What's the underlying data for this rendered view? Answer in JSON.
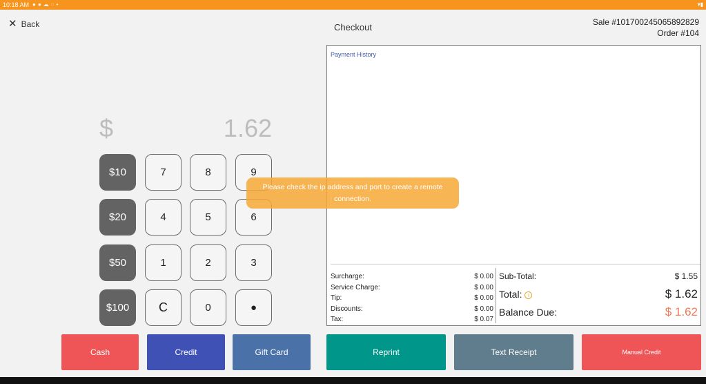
{
  "status_bar": {
    "time": "10:18 AM",
    "icons": [
      "sync-icon",
      "check-icon",
      "cloud-icon",
      "alert-icon",
      "dot-icon"
    ]
  },
  "header": {
    "back_label": "Back",
    "title": "Checkout",
    "sale_number": "Sale #1017002450658​92829",
    "order_number": "Order #104"
  },
  "amount": {
    "currency": "$",
    "value": "1.62"
  },
  "keypad": {
    "presets": [
      "$10",
      "$20",
      "$50",
      "$100"
    ],
    "digits": [
      "7",
      "8",
      "9",
      "4",
      "5",
      "6",
      "1",
      "2",
      "3",
      "C",
      "0",
      "●"
    ]
  },
  "payment_history": {
    "label": "Payment History"
  },
  "fees": [
    {
      "label": "Surcharge:",
      "value": "$ 0.00"
    },
    {
      "label": "Service Charge:",
      "value": "$ 0.00"
    },
    {
      "label": "Tip:",
      "value": "$ 0.00"
    },
    {
      "label": "Discounts:",
      "value": "$ 0.00"
    },
    {
      "label": "Tax:",
      "value": "$ 0.07"
    }
  ],
  "totals": {
    "subtotal_label": "Sub-Total:",
    "subtotal_value": "$ 1.55",
    "total_label": "Total:",
    "total_value": "$ 1.62",
    "balance_label": "Balance Due:",
    "balance_value": "$ 1.62"
  },
  "toast": {
    "message": "Please check the ip address and port to create a remote connection."
  },
  "buttons": {
    "cash": "Cash",
    "credit": "Credit",
    "gift_card": "Gift Card",
    "reprint": "Reprint",
    "text_receipt": "Text Receipt",
    "manual_credit": "Manual Credit"
  },
  "colors": {
    "status_bar": "#f7941d",
    "cash": "#ef5456",
    "credit": "#3f51b5",
    "gift_card": "#4a72a8",
    "reprint": "#00968a",
    "text_receipt": "#5f7d8c",
    "manual_credit": "#ef5456",
    "balance_due": "#f07856"
  }
}
